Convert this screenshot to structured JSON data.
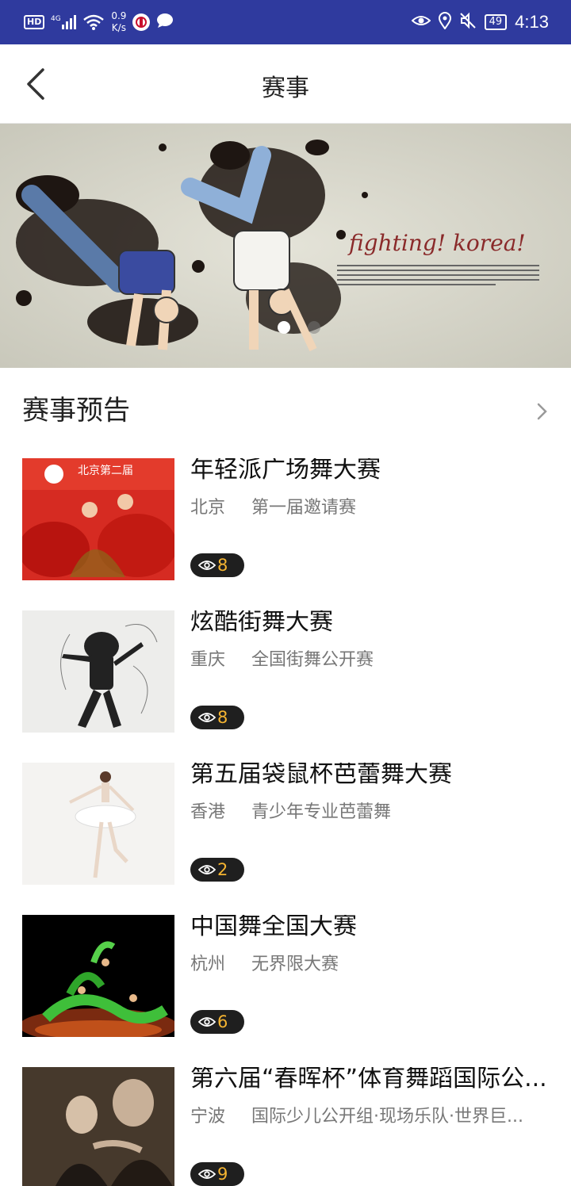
{
  "status_bar": {
    "hd": "HD",
    "net_speed_top": "0.9",
    "net_speed_bottom": "K/s",
    "battery": "49",
    "time": "4:13"
  },
  "header": {
    "title": "赛事"
  },
  "banner": {
    "headline": "fighting!  korea!",
    "slides": 2,
    "active_slide": 1
  },
  "section": {
    "title": "赛事预告"
  },
  "events": [
    {
      "title": "年轻派广场舞大赛",
      "city": "北京",
      "desc": "第一届邀请赛",
      "views": "8"
    },
    {
      "title": "炫酷街舞大赛",
      "city": "重庆",
      "desc": "全国街舞公开赛",
      "views": "8"
    },
    {
      "title": "第五届袋鼠杯芭蕾舞大赛",
      "city": "香港",
      "desc": "青少年专业芭蕾舞",
      "views": "2"
    },
    {
      "title": "中国舞全国大赛",
      "city": "杭州",
      "desc": "无界限大赛",
      "views": "6"
    },
    {
      "title": "第六届“春晖杯”体育舞蹈国际公...",
      "city": "宁波",
      "desc": "国际少儿公开组·现场乐队·世界巨...",
      "views": "9"
    }
  ],
  "colors": {
    "status_bar": "#2f3a9e",
    "badge_bg": "#1f1f1f",
    "badge_text": "#f5b431"
  }
}
